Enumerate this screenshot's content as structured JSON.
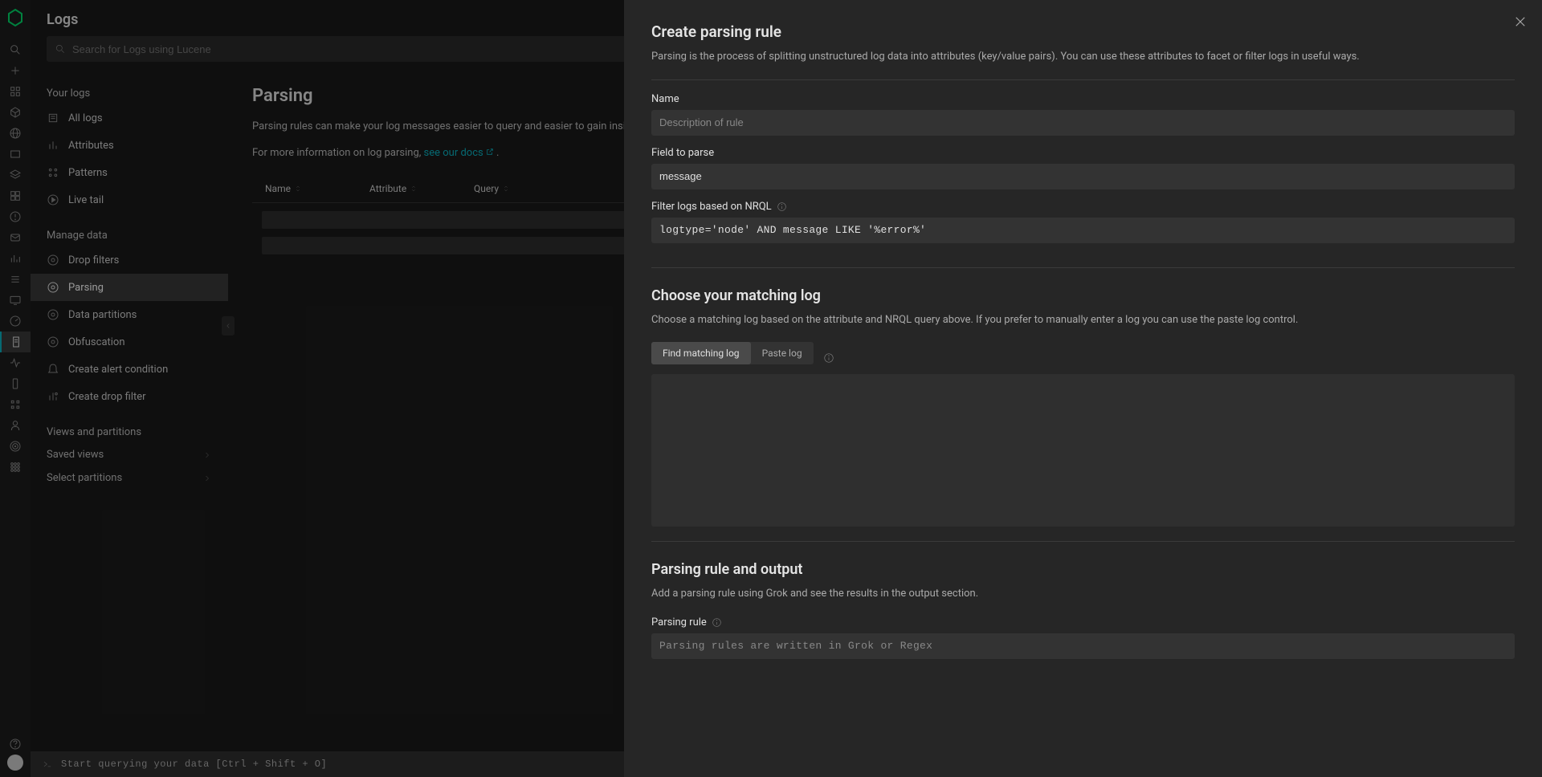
{
  "nav": {
    "logo_color": "#00d969"
  },
  "header": {
    "title": "Logs"
  },
  "search": {
    "placeholder": "Search for Logs using Lucene"
  },
  "sidebar": {
    "section_your_logs": "Your logs",
    "all_logs": "All logs",
    "attributes": "Attributes",
    "patterns": "Patterns",
    "live_tail": "Live tail",
    "section_manage": "Manage data",
    "drop_filters": "Drop filters",
    "parsing": "Parsing",
    "data_partitions": "Data partitions",
    "obfuscation": "Obfuscation",
    "create_alert": "Create alert condition",
    "create_drop": "Create drop filter",
    "section_views": "Views and partitions",
    "saved_views": "Saved views",
    "select_partitions": "Select partitions"
  },
  "main": {
    "heading": "Parsing",
    "desc1": "Parsing rules can make your log messages easier to query and easier to gain insights from. It is important to note that the new rules will only impact the structure of log data stored after the rule is enabled. Previously stored logs will not be changed.",
    "desc2_pre": "For more information on log parsing, ",
    "docs_link": "see our docs",
    "table": {
      "col_name": "Name",
      "col_attr": "Attribute",
      "col_query": "Query"
    }
  },
  "footer": {
    "hint": "Start querying your data [Ctrl + Shift + O]"
  },
  "panel": {
    "title": "Create parsing rule",
    "subtitle": "Parsing is the process of splitting unstructured log data into attributes (key/value pairs). You can use these attributes to facet or filter logs in useful ways.",
    "name_label": "Name",
    "name_placeholder": "Description of rule",
    "field_label": "Field to parse",
    "field_value": "message",
    "nrql_label": "Filter logs based on NRQL",
    "nrql_value": "logtype='node' AND message LIKE '%error%'",
    "choose_title": "Choose your matching log",
    "choose_desc": "Choose a matching log based on the attribute and NRQL query above. If you prefer to manually enter a log you can use the paste log control.",
    "toggle_find": "Find matching log",
    "toggle_paste": "Paste log",
    "rule_title": "Parsing rule and output",
    "rule_desc": "Add a parsing rule using Grok and see the results in the output section.",
    "rule_label": "Parsing rule",
    "rule_placeholder": "Parsing rules are written in Grok or Regex"
  }
}
